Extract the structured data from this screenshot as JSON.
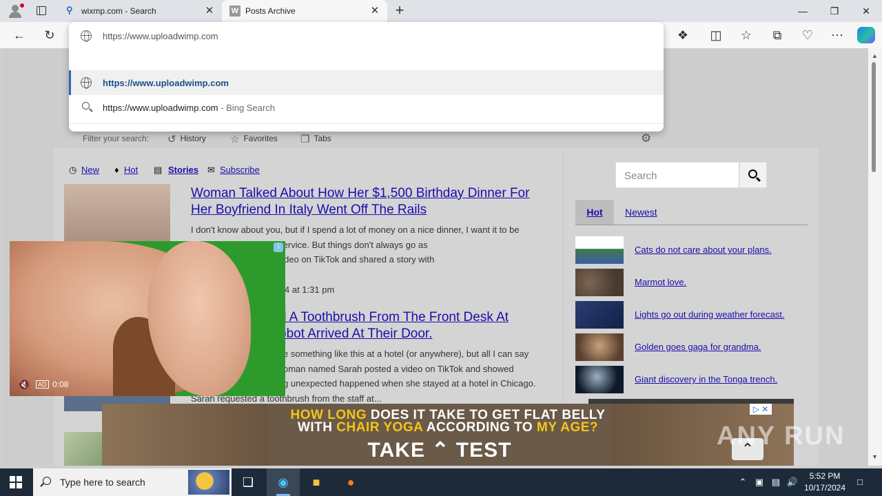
{
  "tabs": [
    {
      "title": "wixmp.com - Search",
      "favicon": "search-icon"
    },
    {
      "title": "Posts Archive",
      "favicon": "W"
    }
  ],
  "window_controls": {
    "minimize": "—",
    "maximize": "❐",
    "close": "✕"
  },
  "omnibox": {
    "typed": "https://www.uploadwimp.com",
    "suggestion_url": "https://www.uploadwimp.com",
    "search_query": "https://www.uploadwimp.com",
    "search_suffix": " - Bing Search",
    "filter_label": "Filter your search:",
    "filters": [
      "History",
      "Favorites",
      "Tabs"
    ]
  },
  "page": {
    "nav": {
      "new": "New",
      "hot": "Hot",
      "stories": "Stories",
      "subscribe": "Subscribe"
    },
    "stories": [
      {
        "title": "Woman Talked About How Her $1,500 Birthday Dinner For Her Boyfriend In Italy Went Off The Rails",
        "excerpt_lines": [
          "I don't know about you, but if I spend a lot of money on a nice dinner, I want it to be",
          "ans the food AND the service. But things don't always go as",
          "amed Kacie posted a video on TikTok and shared a story with",
          "..."
        ],
        "date": "4 at 1:31 pm"
      },
      {
        "title_lines": [
          "d A Toothbrush From The Front Desk At",
          "obot Arrived At Their Door."
        ],
        "excerpt_lines": [
          "e something like this at a hotel (or anywhere), but all I can say",
          "oman named Sarah posted a video on TikTok and showed",
          "g unexpected happened when she stayed at a hotel in Chicago.",
          "Sarah requested a toothbrush from the staff at..."
        ]
      }
    ],
    "sidebar": {
      "search_placeholder": "Search",
      "tab_hot": "Hot",
      "tab_newest": "Newest",
      "items": [
        {
          "label": "Cats do not care about your plans."
        },
        {
          "label": "Marmot love."
        },
        {
          "label": "Lights go out during weather forecast."
        },
        {
          "label": "Golden goes gaga for grandma."
        },
        {
          "label": "Giant discovery in the Tonga trench."
        }
      ]
    }
  },
  "video_ad": {
    "time": "0:08",
    "ad_tag": "AD"
  },
  "banner_ad": {
    "line1_a": "HOW LONG",
    "line1_b": " DOES IT TAKE TO GET ",
    "line1_c": "FLAT BELLY",
    "line2_a": "WITH ",
    "line2_b": "CHAIR YOGA",
    "line2_c": " ACCORDING TO ",
    "line2_d": "MY AGE?",
    "cta_a": "TAKE",
    "cta_b": "TEST"
  },
  "watermark": "ANY  RUN",
  "taskbar": {
    "search_placeholder": "Type here to search",
    "time": "5:52 PM",
    "date": "10/17/2024"
  }
}
